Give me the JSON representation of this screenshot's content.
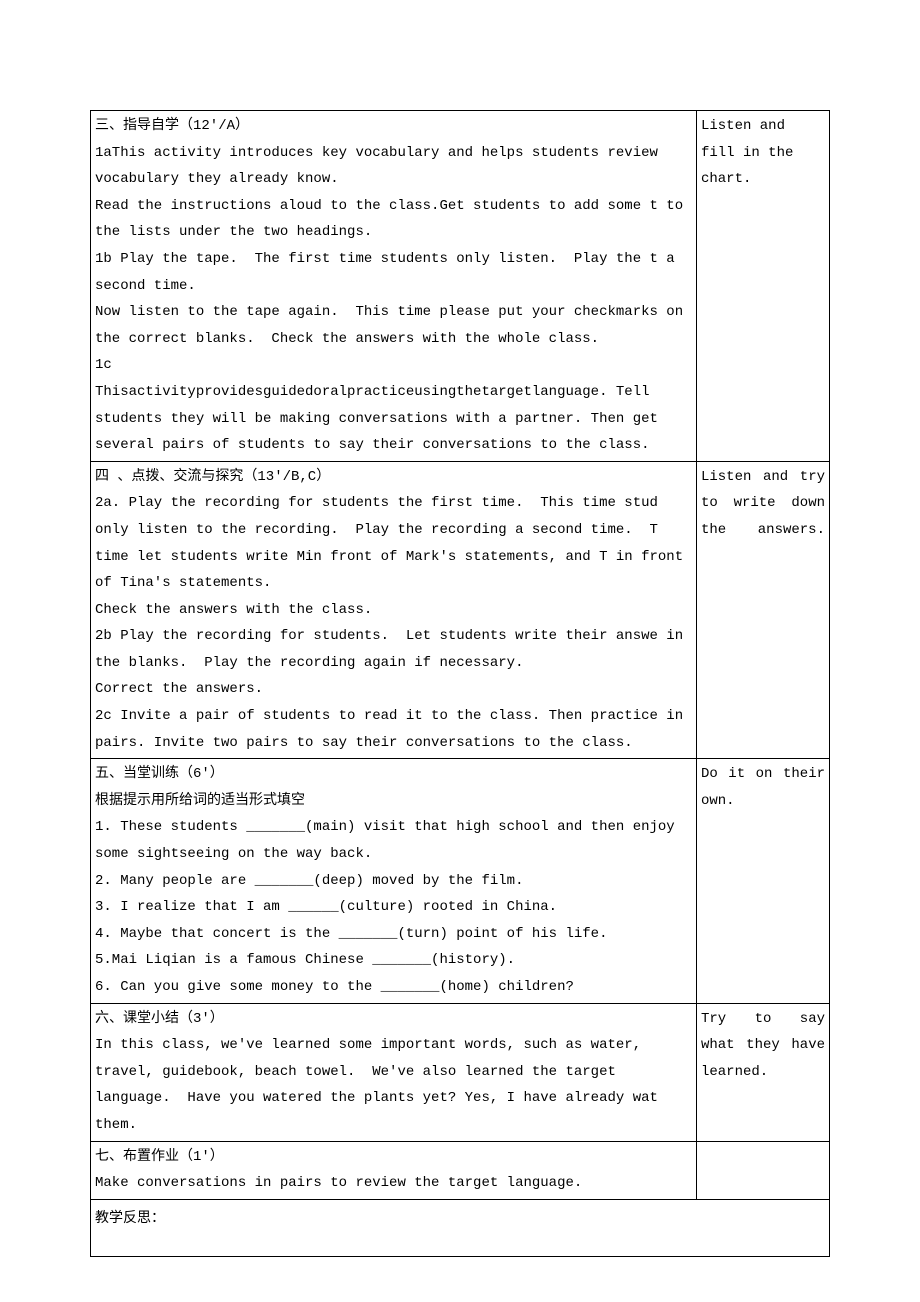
{
  "rows": [
    {
      "main": "三、指导自学（12′/A）\n1aThis activity introduces key vocabulary and helps students review vocabulary they already know.\nRead the instructions aloud to the class.Get students to add some t to the lists under the two headings.\n1b Play the tape.  The first time students only listen.  Play the t a second time.\nNow listen to the tape again.  This time please put your checkmarks on the correct blanks.  Check the answers with the whole class.\n1c\nThisactivityprovidesguidedoralpracticeusingthetargetlanguage. Tell students they will be making conversations with a partner. Then get several pairs of students to say their conversations to the class.",
      "side": "Listen and fill in the chart.",
      "sideJustify": false
    },
    {
      "main": "四 、点拨、交流与探究（13′/B,C）\n2a. Play the recording for students the first time.  This time stud only listen to the recording.  Play the recording a second time.  T time let students write Min front of Mark's statements, and T in front of Tina's statements.\nCheck the answers with the class.\n2b Play the recording for students.  Let students write their answe in the blanks.  Play the recording again if necessary.\nCorrect the answers.\n2c Invite a pair of students to read it to the class. Then practice in pairs. Invite two pairs to say their conversations to the class.",
      "side": " Listen  and try to write down    the answers.",
      "sideJustify": true
    },
    {
      "main": "五、当堂训练（6′）\n根据提示用所给词的适当形式填空\n1. These students _______(main) visit that high school and then enjoy some sightseeing on the way back.\n2. Many people are _______(deep) moved by the film.\n3. I realize that I am ______(culture) rooted in China.\n4. Maybe that concert is the _______(turn) point of his life.\n5.Mai Liqian is a famous Chinese _______(history).\n6. Can you give some money to the _______(home) children?",
      "side": "  Do  it  on their own.",
      "sideJustify": true
    },
    {
      "main": "六、课堂小结（3′）\nIn this class, we've learned some important words, such as water, travel, guidebook, beach towel.  We've also learned the target language.  Have you watered the plants yet? Yes, I have already wat them.",
      "side": "Try  to  say what    they have learned.",
      "sideJustify": true
    },
    {
      "main": "七、布置作业（1′）\nMake conversations in pairs to review the target language.",
      "side": "",
      "sideJustify": false
    }
  ],
  "reflection": "教学反思："
}
